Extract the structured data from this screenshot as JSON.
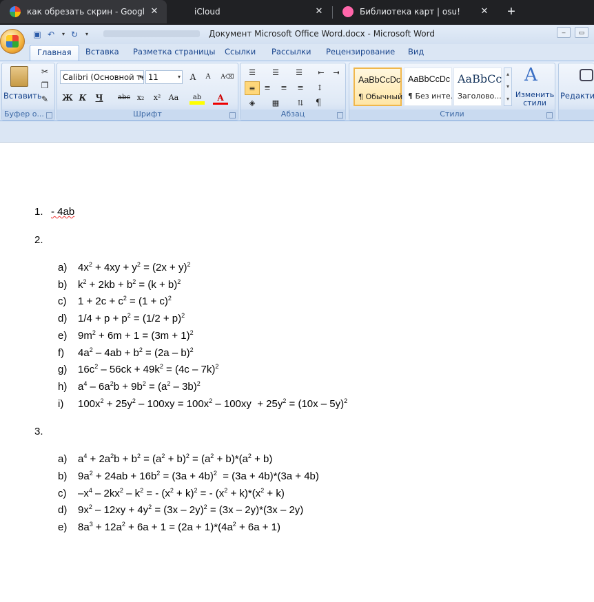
{
  "browser": {
    "tabs": [
      {
        "title": "как обрезать скрин - Google Se",
        "icon": "google-icon",
        "active": true
      },
      {
        "title": "iCloud",
        "icon": "apple-icon",
        "active": false
      },
      {
        "title": "Библиотека карт | osu!",
        "icon": "osu-icon",
        "active": false
      }
    ],
    "new_tab": "+"
  },
  "word": {
    "title": "Документ Microsoft Office Word.docx - Microsoft Word",
    "ribbon_tabs": [
      "Главная",
      "Вставка",
      "Разметка страницы",
      "Ссылки",
      "Рассылки",
      "Рецензирование",
      "Вид"
    ],
    "clipboard": {
      "paste": "Вставить",
      "label": "Буфер о..."
    },
    "font": {
      "family": "Calibri (Основной те",
      "size": "11",
      "label": "Шрифт",
      "bold": "Ж",
      "italic": "К",
      "underline": "Ч",
      "strike": "abc",
      "sub": "x₂",
      "sup": "x²",
      "case": "Aa"
    },
    "paragraph": {
      "label": "Абзац"
    },
    "styles": {
      "label": "Стили",
      "items": [
        {
          "preview": "AaBbCcDc",
          "name": "¶ Обычный"
        },
        {
          "preview": "AaBbCcDc",
          "name": "¶ Без инте..."
        },
        {
          "preview": "AaBbCc",
          "name": "Заголово..."
        }
      ],
      "change": "Изменить стили"
    },
    "editing": {
      "label": "Редактир"
    }
  },
  "document": {
    "task1": {
      "num": "1.",
      "text": "- 4ab"
    },
    "task2": {
      "num": "2.",
      "items": [
        {
          "letter": "a)",
          "html": "4x<sup>2</sup> + 4xy + y<sup>2</sup> = (2x + y)<sup>2</sup>"
        },
        {
          "letter": "b)",
          "html": "k<sup>2</sup> + 2kb + b<sup>2</sup> = (k + b)<sup>2</sup>"
        },
        {
          "letter": "c)",
          "html": "1 + 2c + c<sup>2</sup> = (1 + c)<sup>2</sup>"
        },
        {
          "letter": "d)",
          "html": "1/4 + p + p<sup>2</sup> = (1/2 + p)<sup>2</sup>"
        },
        {
          "letter": "e)",
          "html": "9m<sup>2</sup> + 6m + 1 = (3m + 1)<sup>2</sup>"
        },
        {
          "letter": "f)",
          "html": "4a<sup>2</sup> – 4ab + b<sup>2</sup> = (2a – b)<sup>2</sup>"
        },
        {
          "letter": "g)",
          "html": "16c<sup>2</sup> – 56ck + 49k<sup>2</sup> = (4c – 7k)<sup>2</sup>"
        },
        {
          "letter": "h)",
          "html": "a<sup>4</sup> – 6a<sup>2</sup>b + 9b<sup>2</sup> = (a<sup>2</sup> – 3b)<sup>2</sup>"
        },
        {
          "letter": "i)",
          "html": "100x<sup>2</sup> + 25y<sup>2</sup> – 100xy = 100x<sup>2</sup> – 100xy &nbsp;+ 25y<sup>2</sup> = (10x – 5y)<sup>2</sup>"
        }
      ]
    },
    "task3": {
      "num": "3.",
      "items": [
        {
          "letter": "a)",
          "html": "a<sup>4</sup> + 2a<sup>2</sup>b + b<sup>2</sup> = (a<sup>2</sup> + b)<sup>2</sup> = (a<sup>2</sup> + b)*(a<sup>2</sup> + b)"
        },
        {
          "letter": "b)",
          "html": "9a<sup>2</sup> + 24ab + 16b<sup>2</sup> = (3a + 4b)<sup>2</sup> &nbsp;= (3a + 4b)*(3a + 4b)"
        },
        {
          "letter": "c)",
          "html": "–x<sup>4</sup> – 2kx<sup>2</sup> – k<sup>2</sup> = - (x<sup>2</sup> + k)<sup>2</sup> = - (x<sup>2</sup> + k)*(x<sup>2</sup> + k)"
        },
        {
          "letter": "d)",
          "html": "9x<sup>2</sup> – 12xy + 4y<sup>2</sup> = (3x – 2y)<sup>2</sup> = (3x – 2y)*(3x – 2y)"
        },
        {
          "letter": "e)",
          "html": "8a<sup>3</sup> + 12a<sup>2</sup> + 6a + 1 = (2a + 1)*(4a<sup>2</sup> + 6a + 1)"
        }
      ]
    }
  }
}
